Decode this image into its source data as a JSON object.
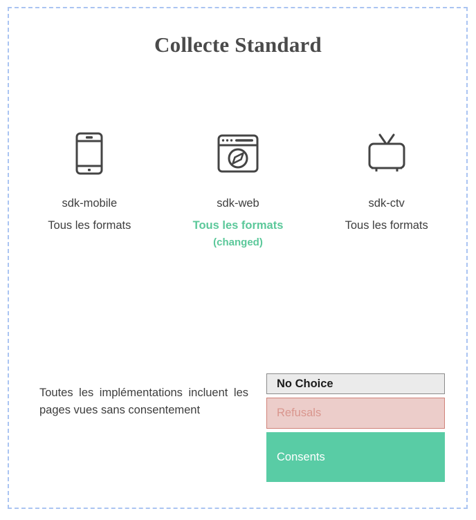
{
  "slide": {
    "title": "Collecte Standard",
    "frame_color": "#aac4f2"
  },
  "sdks": [
    {
      "icon": "mobile-phone-icon",
      "name": "sdk-mobile",
      "formats": "Tous les formats",
      "changed": false,
      "changed_note": ""
    },
    {
      "icon": "browser-window-compass-icon",
      "name": "sdk-web",
      "formats": "Tous les formats",
      "changed": true,
      "changed_note": "(changed)"
    },
    {
      "icon": "television-icon",
      "name": "sdk-ctv",
      "formats": "Tous les formats",
      "changed": false,
      "changed_note": ""
    }
  ],
  "bottom": {
    "note": "Toutes les implémentations incluent les pages vues sans consentement",
    "bars": [
      {
        "label": "No Choice",
        "fill": "#ebebeb",
        "border": "#8a8a8a",
        "text_color": "#1c1c1c"
      },
      {
        "label": "Refusals",
        "fill": "#eccdca",
        "border": "#cf8178",
        "text_color": "#d9968e"
      },
      {
        "label": "Consents",
        "fill": "#59cca5",
        "border": "#59cca5",
        "text_color": "#ffffff"
      }
    ]
  },
  "colors": {
    "accent_green": "#5bc89a",
    "bar_green": "#59cca5",
    "bar_pink": "#eccdca",
    "bar_gray": "#ebebeb",
    "text_dark": "#3d3d3d",
    "frame_blue": "#aac4f2"
  }
}
